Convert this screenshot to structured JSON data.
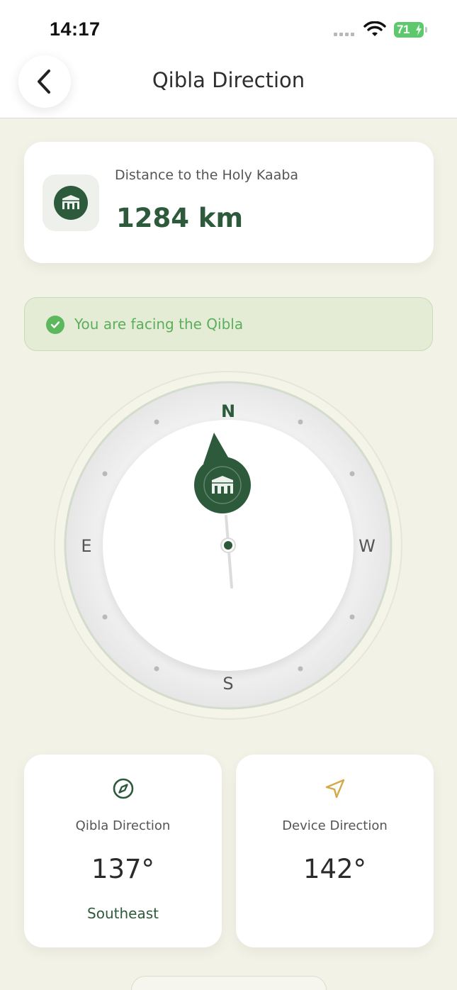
{
  "status_bar": {
    "time": "14:17",
    "battery": "71",
    "icons": [
      "signal-dots-icon",
      "wifi-icon",
      "battery-icon",
      "charging-bolt-icon"
    ]
  },
  "header": {
    "title": "Qibla Direction",
    "back_icon": "chevron-left-icon"
  },
  "distance": {
    "label": "Distance to the Holy Kaaba",
    "value": "1284 km",
    "icon": "kaaba-icon"
  },
  "alert": {
    "text": "You are facing the Qibla",
    "icon": "check-circle-icon"
  },
  "compass": {
    "north": "N",
    "east": "E",
    "south": "S",
    "west": "W"
  },
  "stats": {
    "qibla": {
      "label": "Qibla Direction",
      "value": "137°",
      "sub": "Southeast",
      "icon": "compass-icon"
    },
    "device": {
      "label": "Device Direction",
      "value": "142°",
      "icon": "navigation-arrow-icon"
    }
  },
  "colors": {
    "primary_green": "#2e5a3c",
    "background": "#f3f2e6",
    "success_green": "#5cb85c",
    "alert_bg": "#e4ecd6",
    "accent_gold": "#d4a94a"
  }
}
